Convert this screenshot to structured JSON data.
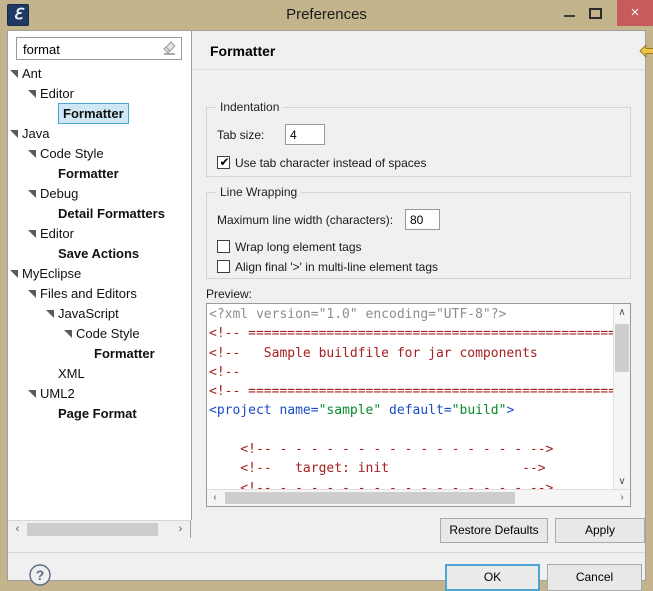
{
  "window": {
    "title": "Preferences",
    "app_icon": "myeclipse-logo-icon",
    "minimize_label": "",
    "maximize_label": "",
    "close_label": "×"
  },
  "filter": {
    "value": "format",
    "placeholder": "type filter text",
    "clear_icon": "eraser-icon"
  },
  "tree": {
    "items": [
      {
        "label": "Ant",
        "indent": 0,
        "expander": "expanded",
        "bold": false,
        "selected": false
      },
      {
        "label": "Editor",
        "indent": 1,
        "expander": "expanded",
        "bold": false,
        "selected": false
      },
      {
        "label": "Formatter",
        "indent": 2,
        "expander": "none",
        "bold": true,
        "selected": true
      },
      {
        "label": "Java",
        "indent": 0,
        "expander": "expanded",
        "bold": false,
        "selected": false
      },
      {
        "label": "Code Style",
        "indent": 1,
        "expander": "expanded",
        "bold": false,
        "selected": false
      },
      {
        "label": "Formatter",
        "indent": 2,
        "expander": "none",
        "bold": true,
        "selected": false
      },
      {
        "label": "Debug",
        "indent": 1,
        "expander": "expanded",
        "bold": false,
        "selected": false
      },
      {
        "label": "Detail Formatters",
        "indent": 2,
        "expander": "none",
        "bold": true,
        "selected": false
      },
      {
        "label": "Editor",
        "indent": 1,
        "expander": "expanded",
        "bold": false,
        "selected": false
      },
      {
        "label": "Save Actions",
        "indent": 2,
        "expander": "none",
        "bold": true,
        "selected": false
      },
      {
        "label": "MyEclipse",
        "indent": 0,
        "expander": "expanded",
        "bold": false,
        "selected": false
      },
      {
        "label": "Files and Editors",
        "indent": 1,
        "expander": "expanded",
        "bold": false,
        "selected": false
      },
      {
        "label": "JavaScript",
        "indent": 2,
        "expander": "expanded",
        "bold": false,
        "selected": false
      },
      {
        "label": "Code Style",
        "indent": 3,
        "expander": "expanded",
        "bold": false,
        "selected": false
      },
      {
        "label": "Formatter",
        "indent": 4,
        "expander": "none",
        "bold": true,
        "selected": false
      },
      {
        "label": "XML",
        "indent": 2,
        "expander": "none",
        "bold": false,
        "selected": false
      },
      {
        "label": "UML2",
        "indent": 1,
        "expander": "expanded",
        "bold": false,
        "selected": false
      },
      {
        "label": "Page Format",
        "indent": 2,
        "expander": "none",
        "bold": true,
        "selected": false
      }
    ],
    "hscroll": {
      "left_arrow": "‹",
      "right_arrow": "›"
    }
  },
  "page": {
    "title": "Formatter",
    "nav": {
      "back_icon": "back-arrow-icon",
      "back_menu_icon": "chevron-down-icon",
      "forward_icon": "forward-arrow-icon",
      "forward_menu_icon": "chevron-down-icon",
      "page_menu_icon": "chevron-down-icon"
    }
  },
  "indentation": {
    "legend": "Indentation",
    "tab_size_label": "Tab size:",
    "tab_size_value": "4",
    "use_tab_char_label": "Use tab character instead of spaces",
    "use_tab_char_checked": true,
    "check_glyph": "✔"
  },
  "line_wrapping": {
    "legend": "Line Wrapping",
    "max_width_label": "Maximum line width (characters):",
    "max_width_value": "80",
    "wrap_long_tags_label": "Wrap long element tags",
    "wrap_long_tags_checked": false,
    "align_final_label": "Align final '>' in multi-line element tags",
    "align_final_checked": false
  },
  "preview": {
    "label": "Preview:",
    "lines": [
      [
        {
          "t": "<?xml version=\"1.0\" encoding=\"UTF-8\"?>",
          "c": "c-decl"
        }
      ],
      [
        {
          "t": "<!-- ===============================================",
          "c": "c-comment"
        }
      ],
      [
        {
          "t": "<!--   Sample buildfile for jar components",
          "c": "c-comment"
        }
      ],
      [
        {
          "t": "<!--",
          "c": "c-comment"
        }
      ],
      [
        {
          "t": "<!-- ===============================================",
          "c": "c-comment"
        }
      ],
      [
        {
          "t": "<project ",
          "c": "c-tag"
        },
        {
          "t": "name=",
          "c": "c-attr"
        },
        {
          "t": "\"sample\"",
          "c": "c-val"
        },
        {
          "t": " default=",
          "c": "c-attr"
        },
        {
          "t": "\"build\"",
          "c": "c-val"
        },
        {
          "t": ">",
          "c": "c-tag"
        }
      ],
      [
        {
          "t": "",
          "c": "c-comment"
        }
      ],
      [
        {
          "t": "    <!-- - - - - - - - - - - - - - - - - -->",
          "c": "c-comment"
        }
      ],
      [
        {
          "t": "    <!--   target: init                 -->",
          "c": "c-comment"
        }
      ],
      [
        {
          "t": "    <!-- - - - - - - - - - - - - - - - - -->",
          "c": "c-comment"
        }
      ]
    ],
    "vscroll": {
      "up_arrow": "∧",
      "down_arrow": "∨"
    },
    "hscroll": {
      "left_arrow": "‹",
      "right_arrow": "›"
    }
  },
  "buttons": {
    "restore_defaults": "Restore Defaults",
    "apply": "Apply",
    "ok": "OK",
    "cancel": "Cancel",
    "help_icon": "help-question-icon"
  },
  "colors": {
    "titlebar": "#c3b48c",
    "close_button": "#c75b5b",
    "selection": "#cfe8f6",
    "selection_border": "#4ba6d4",
    "comment": "#a52020",
    "tag": "#1a4cc8",
    "value": "#0a8a2a",
    "declaration": "#8d8d8d",
    "back_arrow": "#e8b838"
  }
}
